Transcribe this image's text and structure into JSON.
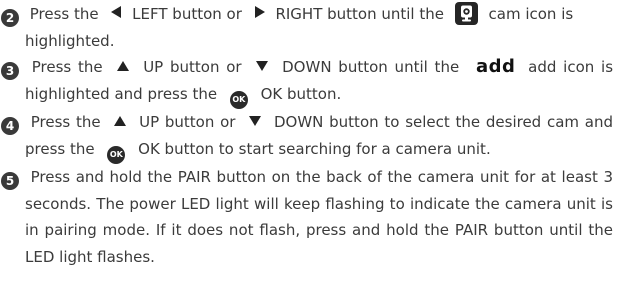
{
  "icons": {
    "ok_label": "OK"
  },
  "steps": [
    {
      "number": "2",
      "parts": {
        "a": "Press the",
        "b": "LEFT button or",
        "c": "RIGHT button until the",
        "d": "cam icon is highlighted."
      },
      "icons": [
        "left-arrow-icon",
        "right-arrow-icon",
        "camera-icon"
      ]
    },
    {
      "number": "3",
      "parts": {
        "a": "Press the",
        "b": "UP button or",
        "c": "DOWN button until the",
        "d": "add",
        "e": "add icon is highlighted and press the",
        "f": "OK button."
      },
      "icons": [
        "up-arrow-icon",
        "down-arrow-icon",
        "ok-icon"
      ]
    },
    {
      "number": "4",
      "parts": {
        "a": "Press the",
        "b": "UP button or",
        "c": "DOWN button to select the desired cam and press the",
        "d": "OK button to start searching for a camera unit."
      },
      "icons": [
        "up-arrow-icon",
        "down-arrow-icon",
        "ok-icon"
      ]
    },
    {
      "number": "5",
      "text": "Press and hold the PAIR button on the back of the camera unit for at least 3 seconds. The power LED light will keep flashing to indicate the camera unit is in pairing mode. If it does not flash, press and hold the PAIR button until the LED light flashes."
    }
  ],
  "colors": {
    "text": "#3b3b3b",
    "icon": "#222222",
    "background": "#ffffff"
  }
}
